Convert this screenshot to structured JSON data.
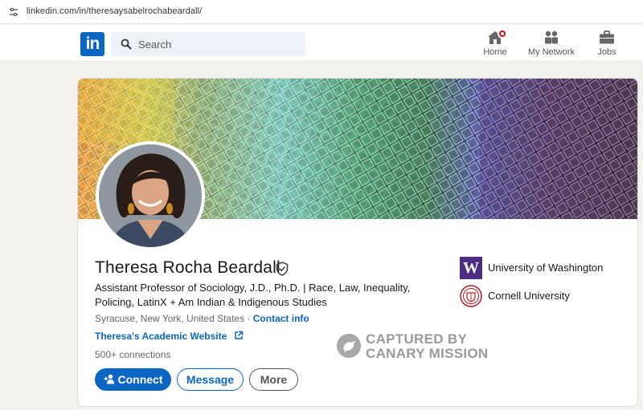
{
  "browser": {
    "url": "linkedin.com/in/theresaysabelrochabeardall/"
  },
  "nav": {
    "search_placeholder": "Search",
    "items": [
      {
        "label": "Home",
        "icon": "home-icon"
      },
      {
        "label": "My Network",
        "icon": "network-icon"
      },
      {
        "label": "Jobs",
        "icon": "briefcase-icon"
      }
    ]
  },
  "profile": {
    "name": "Theresa Rocha Beardall",
    "headline": "Assistant Professor of Sociology, J.D., Ph.D. | Race, Law, Inequality, Policing, LatinX + Am Indian & Indigenous Studies",
    "location": "Syracuse, New York, United States",
    "location_separator": " · ",
    "contact_info": "Contact info",
    "website": "Theresa's Academic Website",
    "connections": "500+ connections",
    "buttons": {
      "connect": "Connect",
      "message": "Message",
      "more": "More"
    },
    "organizations": [
      {
        "name": "University of Washington",
        "logo_letter": "W"
      },
      {
        "name": "Cornell University"
      }
    ]
  },
  "watermark": {
    "line1": "CAPTURED BY",
    "line2": "CANARY MISSION"
  },
  "colors": {
    "linkedin_blue": "#0a66c2",
    "uw_purple": "#4b2e83",
    "cornell_red": "#b31b1b",
    "notification_red": "#cc1016"
  }
}
